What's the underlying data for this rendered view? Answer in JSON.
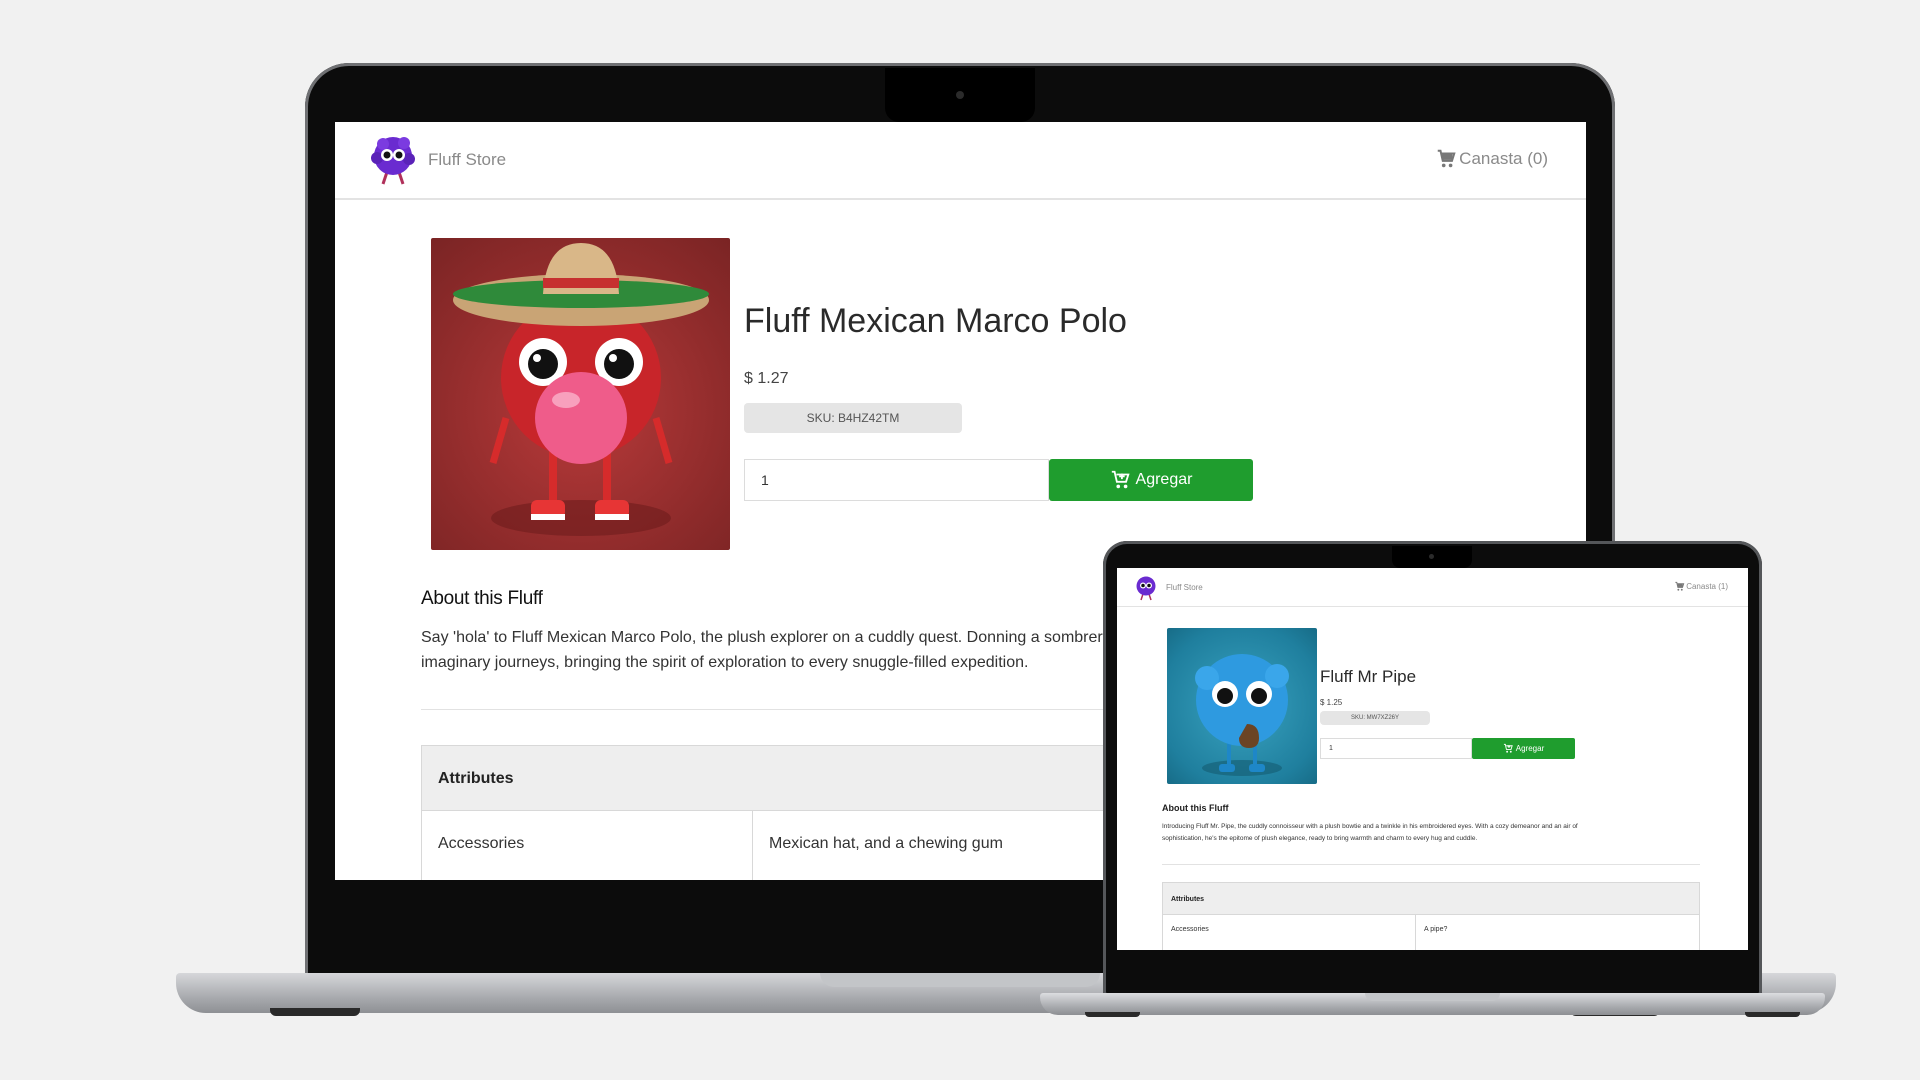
{
  "large_screen": {
    "store_name": "Fluff Store",
    "cart_label": "Canasta (0)",
    "product": {
      "title": "Fluff Mexican Marco Polo",
      "price": "$ 1.27",
      "sku": "SKU: B4HZ42TM",
      "quantity": "1",
      "add_label": "Agregar"
    },
    "about_heading": "About this Fluff",
    "description_line1": "Say 'hola' to Fluff Mexican Marco Polo, the plush explorer on a cuddly quest. Donning a sombrero ar",
    "description_line2": "imaginary journeys, bringing the spirit of exploration to every snuggle-filled expedition.",
    "attributes_heading": "Attributes",
    "attributes": [
      {
        "name": "Accessories",
        "value": "Mexican hat, and a chewing gum"
      }
    ]
  },
  "small_screen": {
    "store_name": "Fluff Store",
    "cart_label": "Canasta (1)",
    "product": {
      "title": "Fluff Mr Pipe",
      "price": "$ 1.25",
      "sku": "SKU: MW7XZ26Y",
      "quantity": "1",
      "add_label": "Agregar"
    },
    "about_heading": "About this Fluff",
    "description_line1": "Introducing Fluff Mr. Pipe, the cuddly connoisseur with a plush bowtie and a twinkle in his embroidered eyes. With a cozy demeanor and an air of",
    "description_line2": "sophistication, he's the epitome of plush elegance, ready to bring warmth and charm to every hug and cuddle.",
    "attributes_heading": "Attributes",
    "attributes": [
      {
        "name": "Accessories",
        "value": "A pipe?"
      }
    ]
  },
  "colors": {
    "accent_green": "#1f9d2e",
    "logo_purple": "#6a2bd0",
    "background": "#f1f1f1"
  },
  "icons": [
    "fluff-logo-icon",
    "cart-icon",
    "add-to-cart-icon"
  ]
}
